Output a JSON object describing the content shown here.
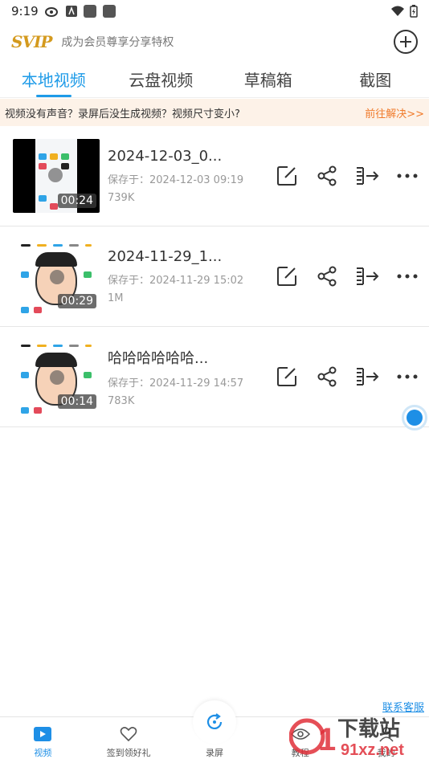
{
  "status": {
    "time": "9:19"
  },
  "header": {
    "logo": "SVIP",
    "promo": "成为会员尊享分享特权"
  },
  "tabs": [
    {
      "label": "本地视频",
      "active": true
    },
    {
      "label": "云盘视频",
      "active": false
    },
    {
      "label": "草稿箱",
      "active": false
    },
    {
      "label": "截图",
      "active": false
    }
  ],
  "notice": {
    "text": "视频没有声音？录屏后没生成视频？视频尺寸变小?",
    "link": "前往解决>>"
  },
  "videos": [
    {
      "title": "2024-12-03_0...",
      "saved": "保存于：2024-12-03 09:19",
      "size": "739K",
      "duration": "00:24"
    },
    {
      "title": "2024-11-29_1...",
      "saved": "保存于：2024-11-29 15:02",
      "size": "1M",
      "duration": "00:29"
    },
    {
      "title": "哈哈哈哈哈哈...",
      "saved": "保存于：2024-11-29 14:57",
      "size": "783K",
      "duration": "00:14"
    }
  ],
  "contact": "联系客服",
  "nav": [
    {
      "label": "视频",
      "active": true
    },
    {
      "label": "签到领好礼",
      "active": false
    },
    {
      "label": "录屏",
      "active": false
    },
    {
      "label": "教程",
      "active": false
    },
    {
      "label": "我的",
      "active": false
    }
  ],
  "watermark": {
    "main": "下载站",
    "domain": "91xz.net"
  },
  "colors": {
    "accent": "#1e9be8",
    "notice_bg": "#fdf2e8",
    "notice_link": "#f07a2a",
    "svip_gold": "#d49a1e"
  }
}
